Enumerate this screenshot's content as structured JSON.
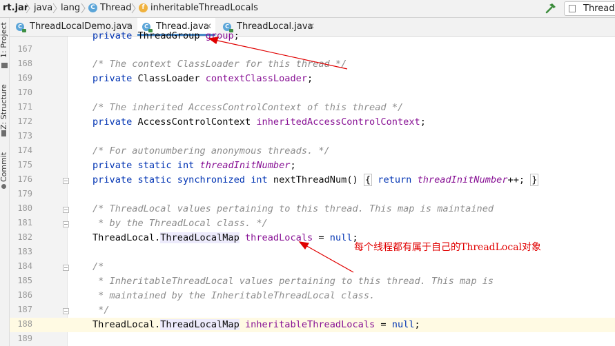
{
  "breadcrumb": {
    "items": [
      "rt.jar",
      "java",
      "lang",
      "Thread",
      "inheritableThreadLocals"
    ],
    "class_icon": "C",
    "field_icon": "f"
  },
  "toolbar": {
    "run_config": "ThreadL"
  },
  "side_panels": [
    "1: Project",
    "Z: Structure",
    "Commit"
  ],
  "tabs": [
    {
      "label": "ThreadLocalDemo.java",
      "active": false
    },
    {
      "label": "Thread.java",
      "active": true
    },
    {
      "label": "ThreadLocal.java",
      "active": false
    }
  ],
  "editor": {
    "current_line": "188",
    "lines": [
      {
        "n": "167",
        "t": "    private ThreadGroup group;"
      },
      {
        "n": "168",
        "t": "    /* The context ClassLoader for this thread */"
      },
      {
        "n": "169",
        "t": "    private ClassLoader contextClassLoader;"
      },
      {
        "n": "170",
        "t": ""
      },
      {
        "n": "171",
        "t": "    /* The inherited AccessControlContext of this thread */"
      },
      {
        "n": "172",
        "t": "    private AccessControlContext inheritedAccessControlContext;"
      },
      {
        "n": "173",
        "t": ""
      },
      {
        "n": "174",
        "t": "    /* For autonumbering anonymous threads. */"
      },
      {
        "n": "175",
        "t": "    private static int threadInitNumber;"
      },
      {
        "n": "176",
        "t": "    private static synchronized int nextThreadNum() { return threadInitNumber++; }"
      },
      {
        "n": "179",
        "t": ""
      },
      {
        "n": "180",
        "t": "    /* ThreadLocal values pertaining to this thread. This map is maintained"
      },
      {
        "n": "181",
        "t": "     * by the ThreadLocal class. */"
      },
      {
        "n": "182",
        "t": "    ThreadLocal.ThreadLocalMap threadLocals = null;"
      },
      {
        "n": "183",
        "t": ""
      },
      {
        "n": "184",
        "t": "    /*"
      },
      {
        "n": "185",
        "t": "     * InheritableThreadLocal values pertaining to this thread. This map is"
      },
      {
        "n": "186",
        "t": "     * maintained by the InheritableThreadLocal class."
      },
      {
        "n": "187",
        "t": "     */"
      },
      {
        "n": "188",
        "t": "    ThreadLocal.ThreadLocalMap inheritableThreadLocals = null;"
      },
      {
        "n": "189",
        "t": ""
      }
    ]
  },
  "annotation": {
    "text": "每个线程都有属于自己的ThreadLocal对象",
    "color": "#e00000"
  },
  "colors": {
    "keyword": "#0033b3",
    "comment": "#8c8c8c",
    "field": "#871094",
    "tab_underline": "#4a88c7",
    "current_line_bg": "#fffae3"
  }
}
